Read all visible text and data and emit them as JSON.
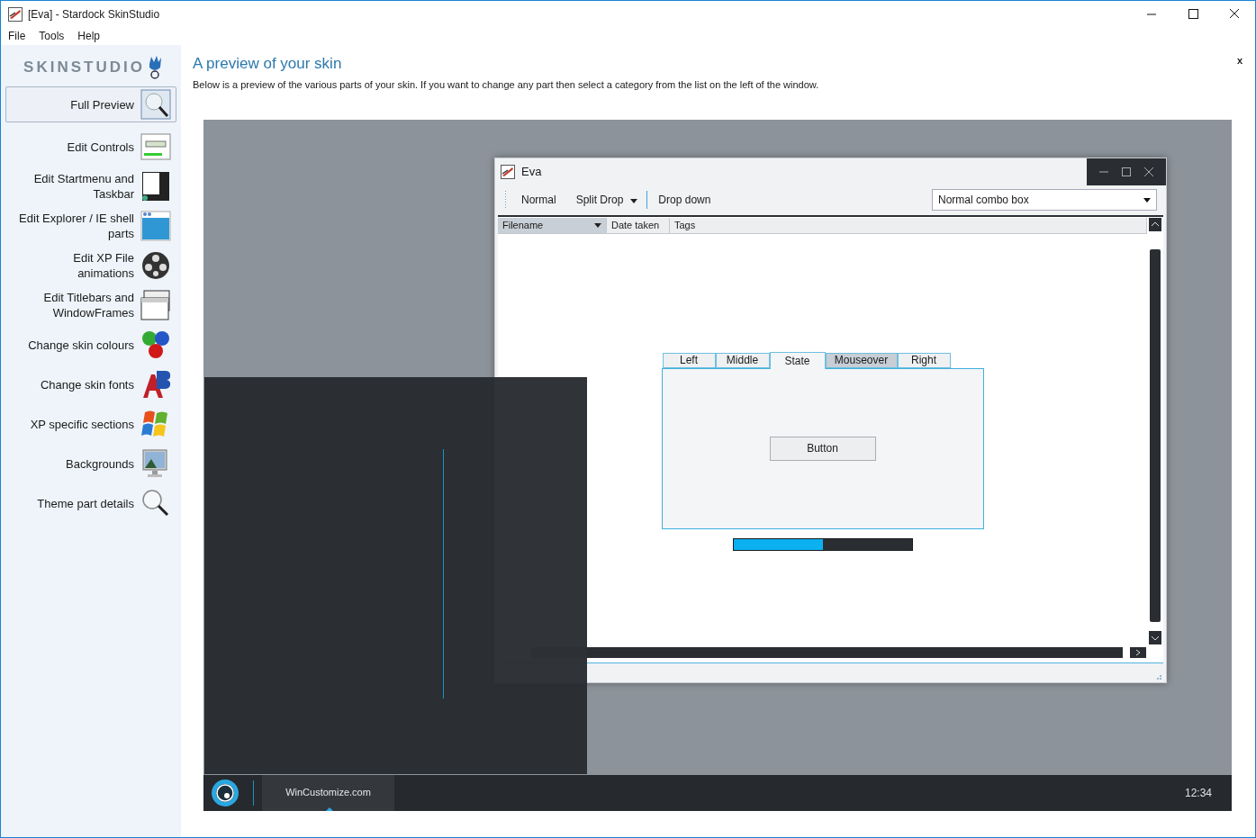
{
  "window": {
    "title": "[Eva] - Stardock SkinStudio"
  },
  "menu": [
    "File",
    "Tools",
    "Help"
  ],
  "sidebar": {
    "logo": "SKINSTUDIO",
    "items": [
      {
        "label": "Full Preview",
        "kind": "preview",
        "selected": true
      },
      {
        "label": "Edit Controls",
        "kind": "controls",
        "selected": false
      },
      {
        "label": "Edit Startmenu and Taskbar",
        "kind": "taskbar",
        "selected": false
      },
      {
        "label": "Edit Explorer / IE shell parts",
        "kind": "explorer",
        "selected": false
      },
      {
        "label": "Edit XP File animations",
        "kind": "film",
        "selected": false
      },
      {
        "label": "Edit Titlebars and WindowFrames",
        "kind": "titlebar",
        "selected": false
      },
      {
        "label": "Change skin colours",
        "kind": "colours",
        "selected": false
      },
      {
        "label": "Change skin fonts",
        "kind": "fonts",
        "selected": false
      },
      {
        "label": "XP specific sections",
        "kind": "flag",
        "selected": false
      },
      {
        "label": "Backgrounds",
        "kind": "backgrounds",
        "selected": false
      },
      {
        "label": "Theme part details",
        "kind": "magnifier",
        "selected": false
      }
    ]
  },
  "content": {
    "heading": "A preview of your skin",
    "description": "Below is a preview of the various parts of your skin.  If you want to change any part then select a category from the list on the left of the window.",
    "close": "x"
  },
  "preview": {
    "window": {
      "title": "Eva",
      "toolbar": [
        {
          "label": "Normal",
          "kind": "button"
        },
        {
          "label": "Split Drop",
          "kind": "split"
        },
        {
          "label": "Drop down",
          "kind": "dropdown"
        }
      ],
      "combo": {
        "value": "Normal combo box"
      },
      "columns": [
        {
          "label": "Filename",
          "sorted": true
        },
        {
          "label": "Date taken",
          "sorted": false
        },
        {
          "label": "Tags",
          "sorted": false
        }
      ],
      "tabs": [
        {
          "label": "Left",
          "selected": false,
          "hovered": false
        },
        {
          "label": "Middle",
          "selected": false,
          "hovered": false
        },
        {
          "label": "State",
          "selected": true,
          "hovered": false
        },
        {
          "label": "Mouseover",
          "selected": false,
          "hovered": true
        },
        {
          "label": "Right",
          "selected": false,
          "hovered": false
        }
      ],
      "button": "Button",
      "progress": {
        "level": 0.5
      }
    },
    "taskbar": {
      "task": "WinCustomize.com",
      "clock": "12:34"
    }
  }
}
